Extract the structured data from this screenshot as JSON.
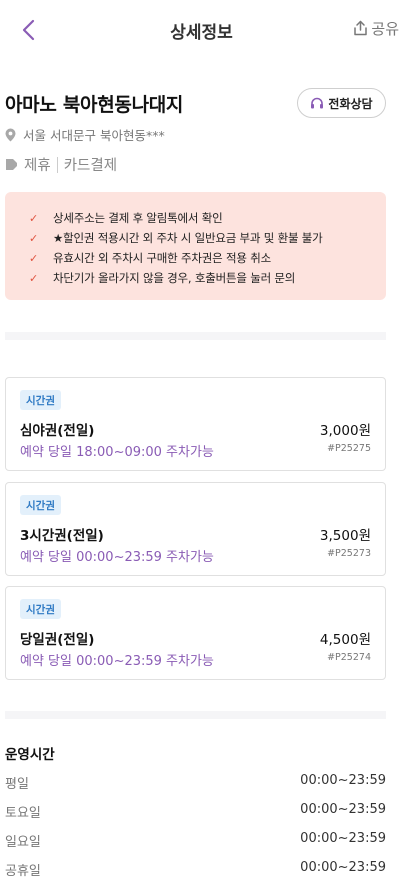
{
  "header": {
    "title": "상세정보",
    "share_label": "공유"
  },
  "place": {
    "name": "아마노 북아현동나대지",
    "call_label": "전화상담",
    "address": "서울 서대문구 북아현동***",
    "tags": [
      "제휴",
      "카드결제"
    ]
  },
  "notices": [
    "상세주소는 결제 후 알림톡에서 확인",
    "★할인권 적용시간 외 주차 시 일반요금 부과 및 환불 불가",
    "유효시간 외 주차시 구매한 주차권은 적용 취소",
    "차단기가 올라가지 않을 경우, 호출버튼을 눌러 문의"
  ],
  "tickets": [
    {
      "badge": "시간권",
      "name": "심야권(전일)",
      "price": "3,000원",
      "availability": "예약 당일 18:00~09:00 주차가능",
      "code": "#P25275"
    },
    {
      "badge": "시간권",
      "name": "3시간권(전일)",
      "price": "3,500원",
      "availability": "예약 당일 00:00~23:59 주차가능",
      "code": "#P25273"
    },
    {
      "badge": "시간권",
      "name": "당일권(전일)",
      "price": "4,500원",
      "availability": "예약 당일 00:00~23:59 주차가능",
      "code": "#P25274"
    }
  ],
  "hours": {
    "title": "운영시간",
    "rows": [
      {
        "day": "평일",
        "time": "00:00~23:59"
      },
      {
        "day": "토요일",
        "time": "00:00~23:59"
      },
      {
        "day": "일요일",
        "time": "00:00~23:59"
      },
      {
        "day": "공휴일",
        "time": "00:00~23:59"
      }
    ]
  },
  "colors": {
    "accent": "#8a5cb5",
    "notice_bg": "#fde3de",
    "check": "#e0533f",
    "badge_bg": "#e3f0fb",
    "badge_text": "#2f7ac4"
  },
  "icons": {
    "back": "chevron-left-icon",
    "share": "share-icon",
    "call": "headset-icon",
    "address": "location-pin-icon",
    "tag": "tag-icon",
    "check": "check-icon"
  }
}
